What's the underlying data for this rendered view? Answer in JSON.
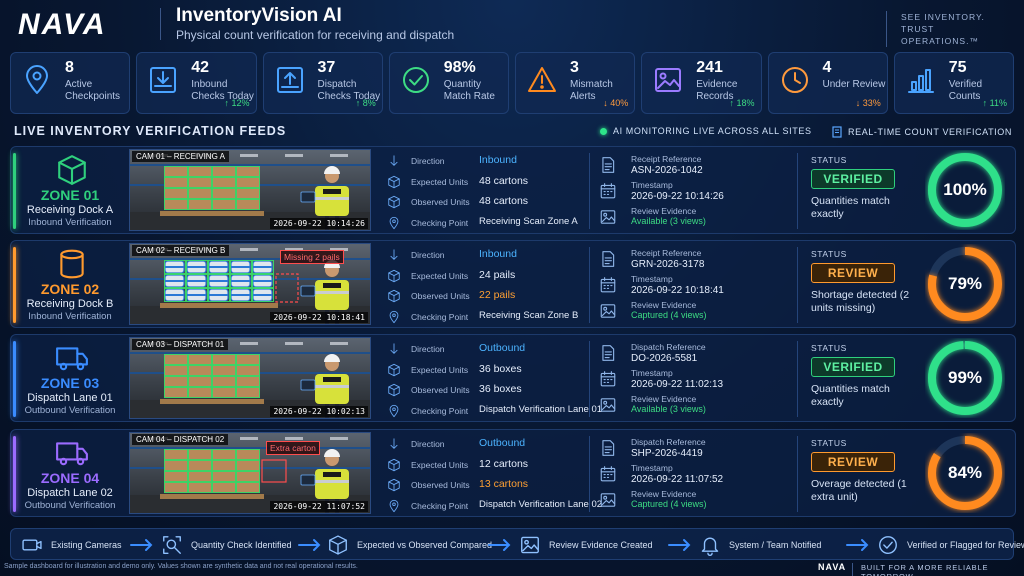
{
  "header": {
    "logo": "NAVA",
    "title": "InventoryVision AI",
    "subtitle": "Physical count verification for receiving and dispatch",
    "tagline": "SEE INVENTORY. TRUST OPERATIONS.™"
  },
  "kpis": [
    {
      "value": "8",
      "label": "Active Checkpoints",
      "delta": "",
      "icon": "location-pin-icon"
    },
    {
      "value": "42",
      "label": "Inbound Checks Today",
      "delta": "↑ 12%",
      "trend": "up",
      "icon": "inbound-tray-icon"
    },
    {
      "value": "37",
      "label": "Dispatch Checks Today",
      "delta": "↑ 8%",
      "trend": "up",
      "icon": "outbound-tray-icon"
    },
    {
      "value": "98%",
      "label": "Quantity Match Rate",
      "delta": "",
      "icon": "check-circle-icon"
    },
    {
      "value": "3",
      "label": "Mismatch Alerts",
      "delta": "↓ 40%",
      "trend": "down",
      "icon": "warning-triangle-icon"
    },
    {
      "value": "241",
      "label": "Evidence Records",
      "delta": "↑ 18%",
      "trend": "up",
      "icon": "image-icon"
    },
    {
      "value": "4",
      "label": "Under Review",
      "delta": "↓ 33%",
      "trend": "down",
      "icon": "clock-icon"
    },
    {
      "value": "75",
      "label": "Verified Counts",
      "delta": "↑ 11%",
      "trend": "up",
      "icon": "bar-chart-icon"
    }
  ],
  "section": {
    "title": "LIVE INVENTORY VERIFICATION FEEDS",
    "live_text": "AI MONITORING LIVE ACROSS ALL SITES",
    "realtime_text": "REAL-TIME COUNT VERIFICATION"
  },
  "labels": {
    "direction": "Direction",
    "expected": "Expected Units",
    "observed": "Observed Units",
    "checking": "Checking Point",
    "timestamp": "Timestamp",
    "review_evidence": "Review Evidence",
    "status": "STATUS"
  },
  "zones": [
    {
      "zone": "ZONE 01",
      "location": "Receiving Dock A",
      "type": "Inbound Verification",
      "color": "#2fd07d",
      "icon": "box-icon",
      "cam_label": "CAM 01 – RECEIVING A",
      "cam_ts": "2026-09-22  10:14:26",
      "alert": "",
      "direction": "Inbound",
      "expected": "48 cartons",
      "observed": "48 cartons",
      "observed_state": "match",
      "checking_point": "Receiving Scan Zone A",
      "ref_label": "Receipt Reference",
      "ref_value": "ASN-2026-1042",
      "timestamp": "2026-09-22  10:14:26",
      "evidence": "Available (3 views)",
      "status": "VERIFIED",
      "status_kind": "ok",
      "note": "Quantities match exactly",
      "percent": 100,
      "percent_text": "100%",
      "gauge_color": "#2fe08a"
    },
    {
      "zone": "ZONE 02",
      "location": "Receiving Dock B",
      "type": "Inbound Verification",
      "color": "#ff9a2e",
      "icon": "barrel-icon",
      "cam_label": "CAM 02 – RECEIVING B",
      "cam_ts": "2026-09-22  10:18:41",
      "alert": "Missing 2 pails",
      "direction": "Inbound",
      "expected": "24 pails",
      "observed": "22 pails",
      "observed_state": "mismatch",
      "checking_point": "Receiving Scan Zone B",
      "ref_label": "Receipt Reference",
      "ref_value": "GRN-2026-3178",
      "timestamp": "2026-09-22  10:18:41",
      "evidence": "Captured (4 views)",
      "status": "REVIEW",
      "status_kind": "review",
      "note": "Shortage detected (2 units missing)",
      "percent": 79,
      "percent_text": "79%",
      "gauge_color": "#ff8a1f"
    },
    {
      "zone": "ZONE 03",
      "location": "Dispatch Lane 01",
      "type": "Outbound Verification",
      "color": "#3a8cff",
      "icon": "truck-icon",
      "cam_label": "CAM 03 – DISPATCH 01",
      "cam_ts": "2026-09-22  10:02:13",
      "alert": "",
      "direction": "Outbound",
      "expected": "36 boxes",
      "observed": "36 boxes",
      "observed_state": "match",
      "checking_point": "Dispatch Verification Lane 01",
      "ref_label": "Dispatch Reference",
      "ref_value": "DO-2026-5581",
      "timestamp": "2026-09-22  11:02:13",
      "evidence": "Available (3 views)",
      "status": "VERIFIED",
      "status_kind": "ok",
      "note": "Quantities match exactly",
      "percent": 99,
      "percent_text": "99%",
      "gauge_color": "#2fe08a"
    },
    {
      "zone": "ZONE 04",
      "location": "Dispatch Lane 02",
      "type": "Outbound Verification",
      "color": "#9b6bff",
      "icon": "truck-icon",
      "cam_label": "CAM 04 – DISPATCH 02",
      "cam_ts": "2026-09-22  11:07:52",
      "alert": "Extra carton",
      "direction": "Outbound",
      "expected": "12 cartons",
      "observed": "13 cartons",
      "observed_state": "mismatch",
      "checking_point": "Dispatch Verification Lane 02",
      "ref_label": "Dispatch Reference",
      "ref_value": "SHP-2026-4419",
      "timestamp": "2026-09-22  11:07:52",
      "evidence": "Captured (4 views)",
      "status": "REVIEW",
      "status_kind": "review",
      "note": "Overage detected (1 extra unit)",
      "percent": 84,
      "percent_text": "84%",
      "gauge_color": "#ff8a1f"
    }
  ],
  "flow": [
    {
      "label": "Existing Cameras",
      "icon": "camera-icon"
    },
    {
      "label": "Quantity Check Identified",
      "icon": "scan-search-icon"
    },
    {
      "label": "Expected vs Observed Compared",
      "icon": "cube-icon"
    },
    {
      "label": "Review Evidence Created",
      "icon": "image-icon"
    },
    {
      "label": "System / Team Notified",
      "icon": "bell-icon"
    },
    {
      "label": "Verified or Flagged for Review",
      "icon": "check-circle-icon"
    }
  ],
  "footer": {
    "disclaimer": "Sample dashboard for illustration and demo only. Values shown are synthetic data and not real operational results.",
    "logo": "NAVA",
    "tagline": "BUILT FOR A MORE RELIABLE TOMORROW."
  }
}
